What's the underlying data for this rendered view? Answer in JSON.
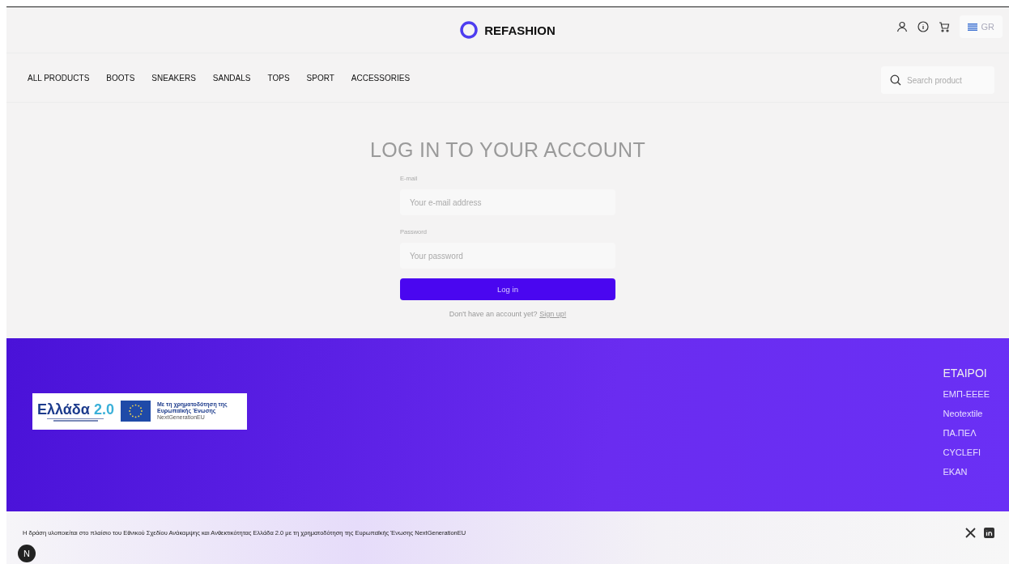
{
  "header": {
    "logo": "REFASHION",
    "language": "GR"
  },
  "nav": {
    "items": [
      {
        "label": "ALL PRODUCTS"
      },
      {
        "label": "BOOTS"
      },
      {
        "label": "SNEAKERS"
      },
      {
        "label": "SANDALS"
      },
      {
        "label": "TOPS"
      },
      {
        "label": "SPORT"
      },
      {
        "label": "ACCESSORIES"
      }
    ],
    "search": {
      "placeholder": "Search product"
    }
  },
  "login": {
    "title": "LOG IN TO YOUR ACCOUNT",
    "fields": [
      {
        "label": "E-mail",
        "placeholder": "Your e-mail address"
      },
      {
        "label": "Password",
        "placeholder": "Your password"
      }
    ],
    "button": "Log in",
    "signup_prompt": "Don't have an account yet?",
    "signup_link": "Sign up!"
  },
  "footer": {
    "funding_logo": {
      "brand": "Ελλάδα",
      "version": "2.0",
      "funding": "Με τη χρηματοδότηση της Ευρωπαϊκής Ένωσης",
      "program": "NextGenerationEU"
    },
    "partners_title": "ΕΤΑΙΡΟΙ",
    "partners": [
      "ΕΜΠ-ΕΕΕΕ",
      "Neotextile",
      "ΠΑ.ΠΕΛ",
      "CYCLEFI",
      "EKAN"
    ]
  },
  "bottom_bar": {
    "text": "Η δράση υλοποιείται στο πλαίσιο του Εθνικού Σχεδίου Ανάκαμψης και Ανθεκτικότητας Ελλάδα 2.0 με τη χρηματοδότηση της Ευρωπαϊκής Ένωσης NextGenerationEU",
    "badge": "N"
  }
}
